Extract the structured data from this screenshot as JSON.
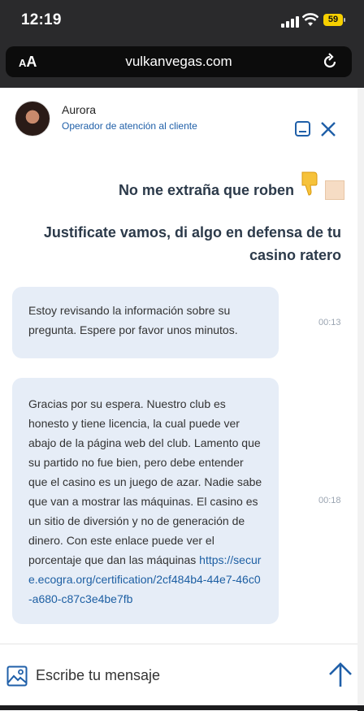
{
  "status_bar": {
    "time": "12:19",
    "battery": "59"
  },
  "browser": {
    "aa_small": "A",
    "aa_big": "A",
    "url": "vulkanvegas.com"
  },
  "chat": {
    "agent_name": "Aurora",
    "agent_role": "Operador de atención al cliente",
    "messages": [
      {
        "from": "user",
        "text": "No me extraña que roben"
      },
      {
        "from": "user",
        "text": "Justificate vamos, di algo en defensa de tu casino ratero"
      },
      {
        "from": "agent",
        "text": "Estoy revisando la información sobre su pregunta. Espere por favor unos minutos.",
        "time": "00:13"
      },
      {
        "from": "agent",
        "text": "Gracias por su espera. Nuestro club es honesto y tiene licencia, la cual puede ver abajo de la página web del club. Lamento que su partido no fue bien, pero debe entender que el casino es un juego de azar. Nadie sabe que van a mostrar las máquinas. El casino es un sitio de diversión y no de generación de dinero. Con este enlace puede ver el porcentaje que dan las máquinas",
        "link": "https://secure.ecogra.org/certification/2cf484b4-44e7-46c0-a680-c87c3e4be7fb",
        "time": "00:18"
      }
    ],
    "composer_placeholder": "Escribe tu mensaje"
  },
  "colors": {
    "accent": "#1f5fa8",
    "bubble": "#e6edf7"
  },
  "icons": [
    "signal-icon",
    "wifi-icon",
    "battery-icon",
    "reload-icon",
    "minimize-icon",
    "close-icon",
    "thumbs-down-emoji",
    "skin-tone-swatch",
    "image-icon",
    "send-arrow-icon"
  ]
}
